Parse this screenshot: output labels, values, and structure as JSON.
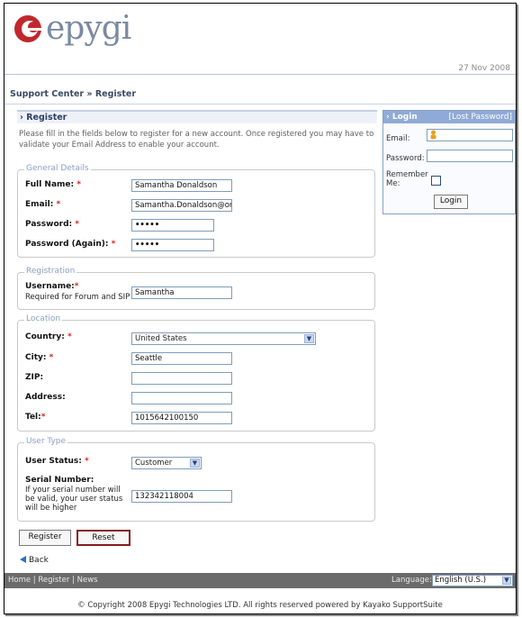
{
  "header": {
    "logo_text": "epygi",
    "date": "27 Nov 2008"
  },
  "breadcrumb": "Support Center » Register",
  "section_title": "› Register",
  "intro": "Please fill in the fields below to register for a new account. Once registered you may have to validate your Email Address to enable your account.",
  "general": {
    "legend": "General Details",
    "full_name_label": "Full Name:",
    "full_name_value": "Samantha Donaldson",
    "email_label": "Email:",
    "email_value": "Samantha.Donaldson@omni",
    "password_label": "Password:",
    "password_value": "•••••",
    "password2_label": "Password (Again):",
    "password2_value": "•••••"
  },
  "registration": {
    "legend": "Registration",
    "username_label": "Username:",
    "username_hint": "Required for Forum and SIP",
    "username_value": "Samantha"
  },
  "location": {
    "legend": "Location",
    "country_label": "Country:",
    "country_value": "United States",
    "city_label": "City:",
    "city_value": "Seattle",
    "zip_label": "ZIP:",
    "zip_value": "",
    "address_label": "Address:",
    "address_value": "",
    "tel_label": "Tel:",
    "tel_value": "1015642100150"
  },
  "user_type": {
    "legend": "User Type",
    "status_label": "User Status:",
    "status_value": "Customer",
    "serial_label": "Serial Number:",
    "serial_hint": "If your serial number will be valid, your user status will be higher",
    "serial_value": "132342118004"
  },
  "buttons": {
    "register": "Register",
    "reset": "Reset",
    "back": "Back"
  },
  "login": {
    "title": "› Login",
    "lost_password": "[Lost Password]",
    "email_label": "Email:",
    "password_label": "Password:",
    "remember_label": "Remember Me:",
    "login_button": "Login"
  },
  "footer": {
    "links": "Home | Register | News",
    "language_label": "Language:",
    "language_value": "English (U.S.)",
    "copyright": "© Copyright 2008 Epygi Technologies LTD. All rights reserved powered by Kayako SupportSuite"
  },
  "colors": {
    "accent": "#8faad6",
    "required": "#d62020",
    "footer_bar": "#6b6b6b"
  }
}
